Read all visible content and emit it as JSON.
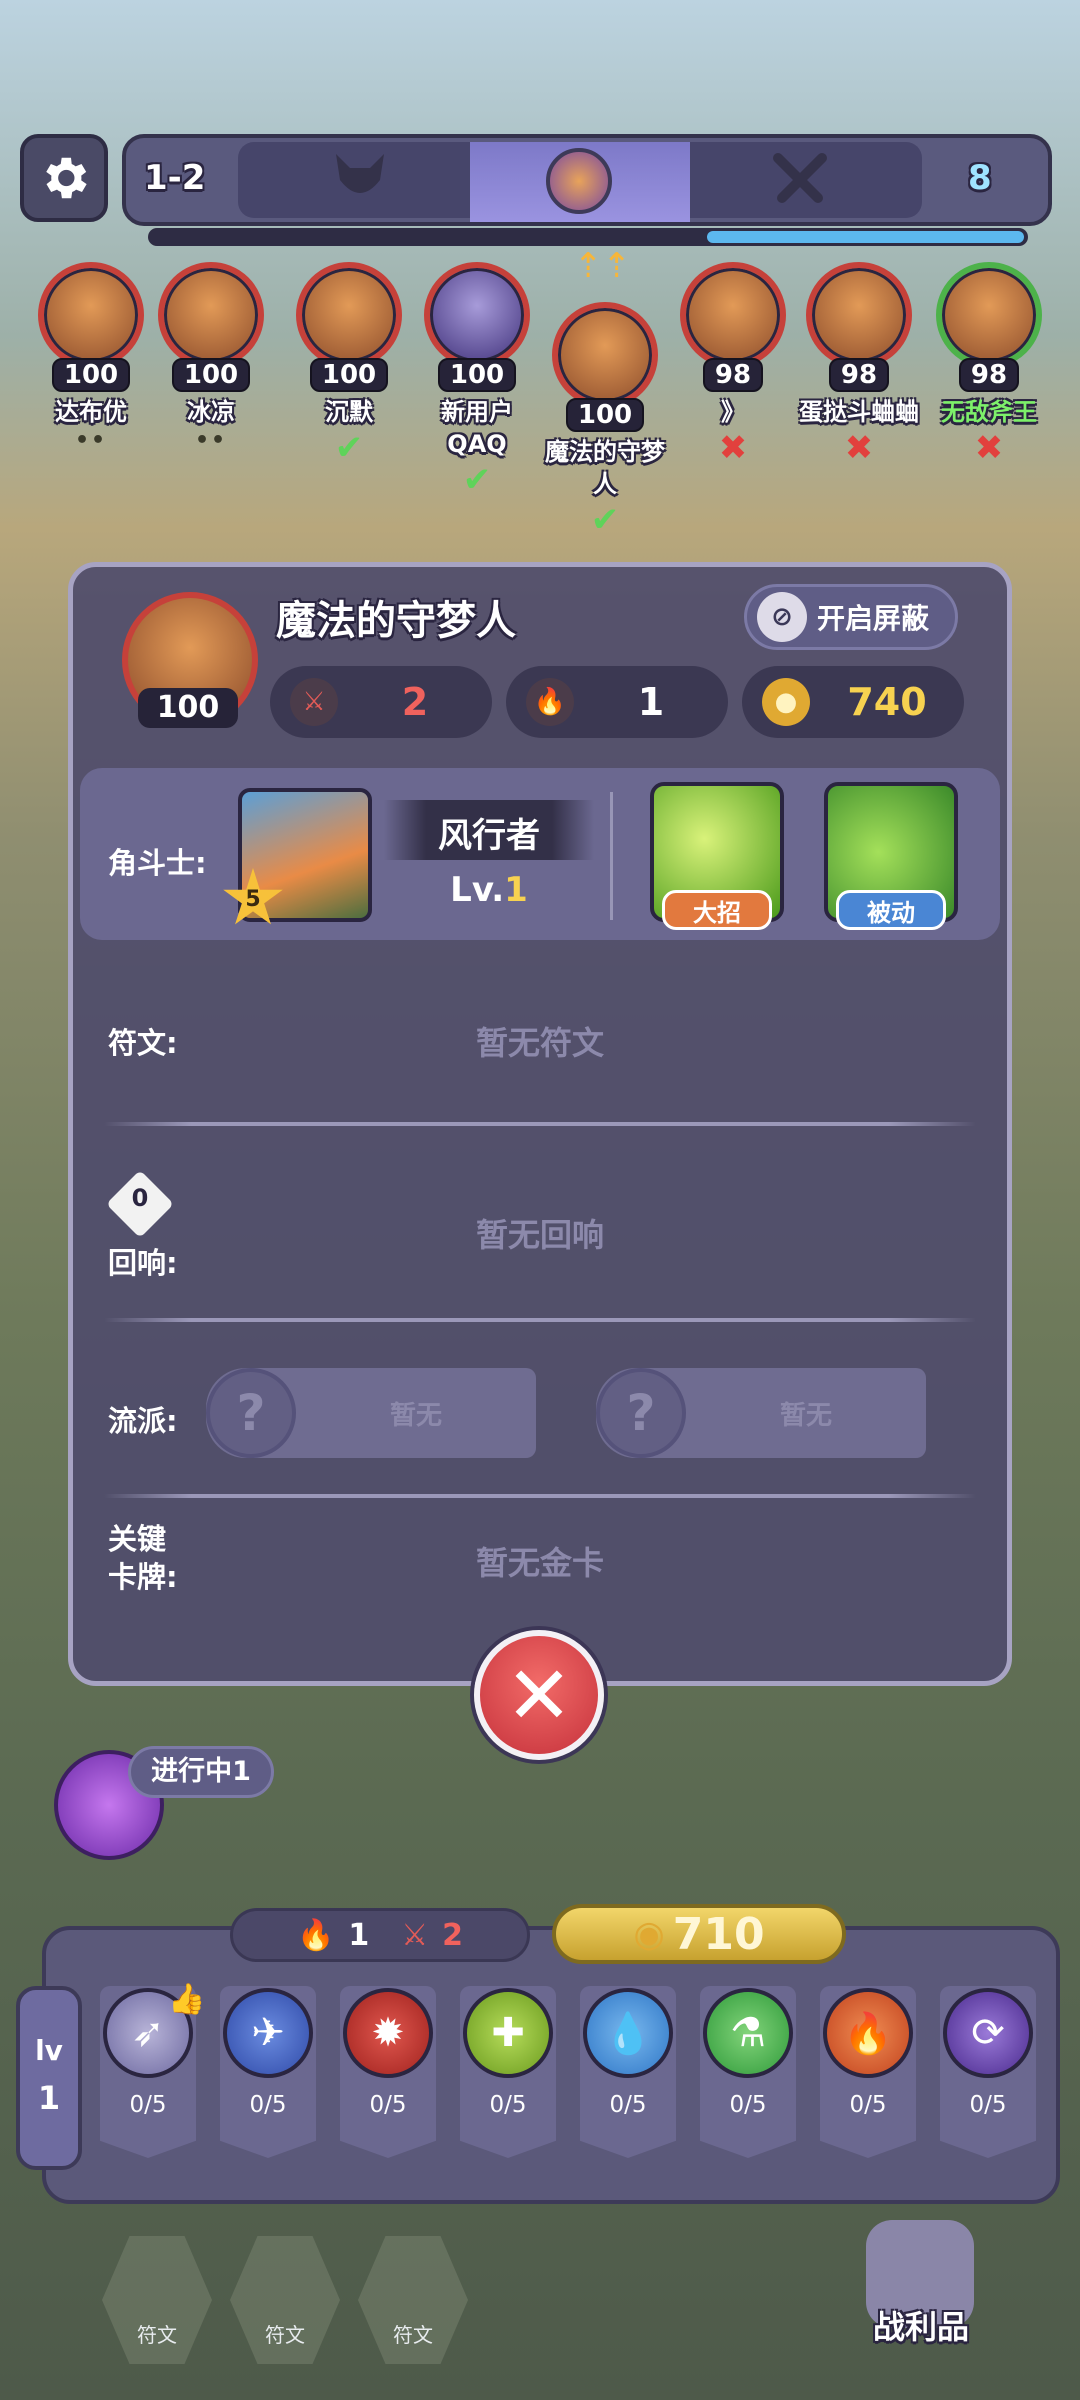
{
  "top_bar": {
    "round": "1-2",
    "stage_icons": [
      "demon-icon",
      "boss-portrait-icon",
      "crossed-swords-icon"
    ],
    "round_count": "8",
    "stage_progress_fraction": 0.36
  },
  "players": [
    {
      "name": "达布优",
      "hp": "100",
      "status": "dots",
      "status_text": "••"
    },
    {
      "name": "冰凉",
      "hp": "100",
      "status": "dots",
      "status_text": "••"
    },
    {
      "name": "沉默",
      "hp": "100",
      "status": "check",
      "status_text": "✔"
    },
    {
      "name": "新用户QAQ",
      "hp": "100",
      "status": "check",
      "status_text": "✔"
    },
    {
      "name": "魔法的守梦人",
      "hp": "100",
      "status": "check",
      "status_text": "✔"
    },
    {
      "name": "》",
      "hp": "98",
      "status": "cross",
      "status_text": "✖"
    },
    {
      "name": "蛋挞斗蛐蛐",
      "hp": "98",
      "status": "cross",
      "status_text": "✖"
    },
    {
      "name": "无敌斧王",
      "hp": "98",
      "status": "cross",
      "status_text": "✖"
    }
  ],
  "modal": {
    "player_name": "魔法的守梦人",
    "hp": "100",
    "shield_button": "开启屏蔽",
    "stats": {
      "attack": "2",
      "streak": "1",
      "gold": "740"
    },
    "champion": {
      "label": "角斗士:",
      "class_name": "风行者",
      "level_prefix": "Lv.",
      "level": "1",
      "star_level": "5",
      "skills": [
        {
          "tag": "大招"
        },
        {
          "tag": "被动"
        }
      ]
    },
    "runes": {
      "label": "符文:",
      "empty": "暂无符文"
    },
    "echo": {
      "label": "回响:",
      "badge": "0",
      "empty": "暂无回响"
    },
    "faction": {
      "label": "流派:",
      "slots": [
        {
          "q": "?",
          "text": "暂无"
        },
        {
          "q": "?",
          "text": "暂无"
        }
      ]
    },
    "key_cards": {
      "label_line1": "关键",
      "label_line2": "卡牌:",
      "empty": "暂无金卡"
    }
  },
  "in_progress": {
    "label": "进行中1"
  },
  "bottom": {
    "streak": "1",
    "attack": "2",
    "gold": "710",
    "lv_label": "lv",
    "lv_value": "1",
    "rune_counts": [
      "0/5",
      "0/5",
      "0/5",
      "0/5",
      "0/5",
      "0/5",
      "0/5",
      "0/5"
    ],
    "rune_slots": [
      "符文",
      "符文",
      "符文"
    ],
    "loot_label": "战利品"
  },
  "colors": {
    "panel": "#504c6c",
    "hp_ring_red": "#c6413a",
    "hp_ring_green": "#4db24a",
    "gold": "#f2d66a",
    "accent_blue": "#5cb8ef"
  }
}
